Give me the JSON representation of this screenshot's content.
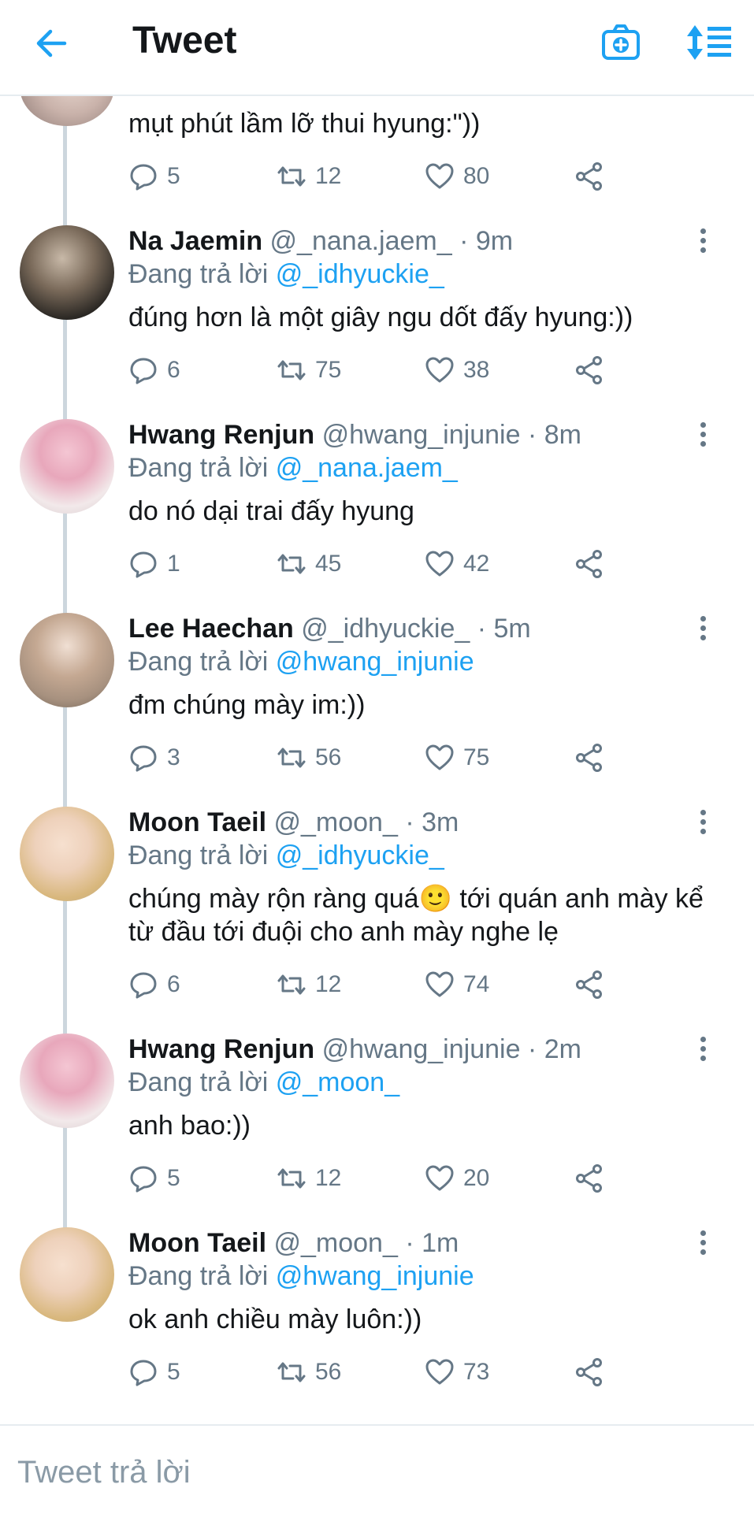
{
  "header": {
    "title": "Tweet"
  },
  "top_partial": {
    "text": "mụt phút lầm lỡ thui hyung:\"))",
    "replies": "5",
    "retweets": "12",
    "likes": "80"
  },
  "tweets": [
    {
      "name": "Na Jaemin",
      "meta": "@_nana.jaem_ · 9m",
      "reply_prefix": "Đang trả lời",
      "reply_to": "@_idhyuckie_",
      "text": "đúng hơn là một giây ngu dốt đấy hyung:))",
      "replies": "6",
      "retweets": "75",
      "likes": "38"
    },
    {
      "name": "Hwang Renjun",
      "meta": "@hwang_injunie · 8m",
      "reply_prefix": "Đang trả lời",
      "reply_to": "@_nana.jaem_",
      "text": "do nó dại trai đấy hyung",
      "replies": "1",
      "retweets": "45",
      "likes": "42"
    },
    {
      "name": "Lee Haechan",
      "meta": "@_idhyuckie_ · 5m",
      "reply_prefix": "Đang trả lời",
      "reply_to": "@hwang_injunie",
      "text": "đm chúng mày im:))",
      "replies": "3",
      "retweets": "56",
      "likes": "75"
    },
    {
      "name": "Moon Taeil",
      "meta": "@_moon_ · 3m",
      "reply_prefix": "Đang trả lời",
      "reply_to": "@_idhyuckie_",
      "text": "chúng mày rộn ràng quá🙂 tới quán anh mày kể từ đầu tới đuội cho anh mày nghe lẹ",
      "replies": "6",
      "retweets": "12",
      "likes": "74"
    },
    {
      "name": "Hwang Renjun",
      "meta": "@hwang_injunie · 2m",
      "reply_prefix": "Đang trả lời",
      "reply_to": "@_moon_",
      "text": "anh bao:))",
      "replies": "5",
      "retweets": "12",
      "likes": "20"
    },
    {
      "name": "Moon Taeil",
      "meta": "@_moon_ · 1m",
      "reply_prefix": "Đang trả lời",
      "reply_to": "@hwang_injunie",
      "text": "ok anh chiều mày luôn:))",
      "replies": "5",
      "retweets": "56",
      "likes": "73"
    }
  ],
  "composer": {
    "placeholder": "Tweet trả lời"
  },
  "colors": {
    "accent": "#1da1f2",
    "secondary_text": "#657786",
    "primary_text": "#14171a"
  },
  "icons": [
    "back-arrow-icon",
    "camera-plus-icon",
    "sort-icon",
    "reply-icon",
    "retweet-icon",
    "like-icon",
    "share-icon",
    "more-vertical-icon"
  ]
}
